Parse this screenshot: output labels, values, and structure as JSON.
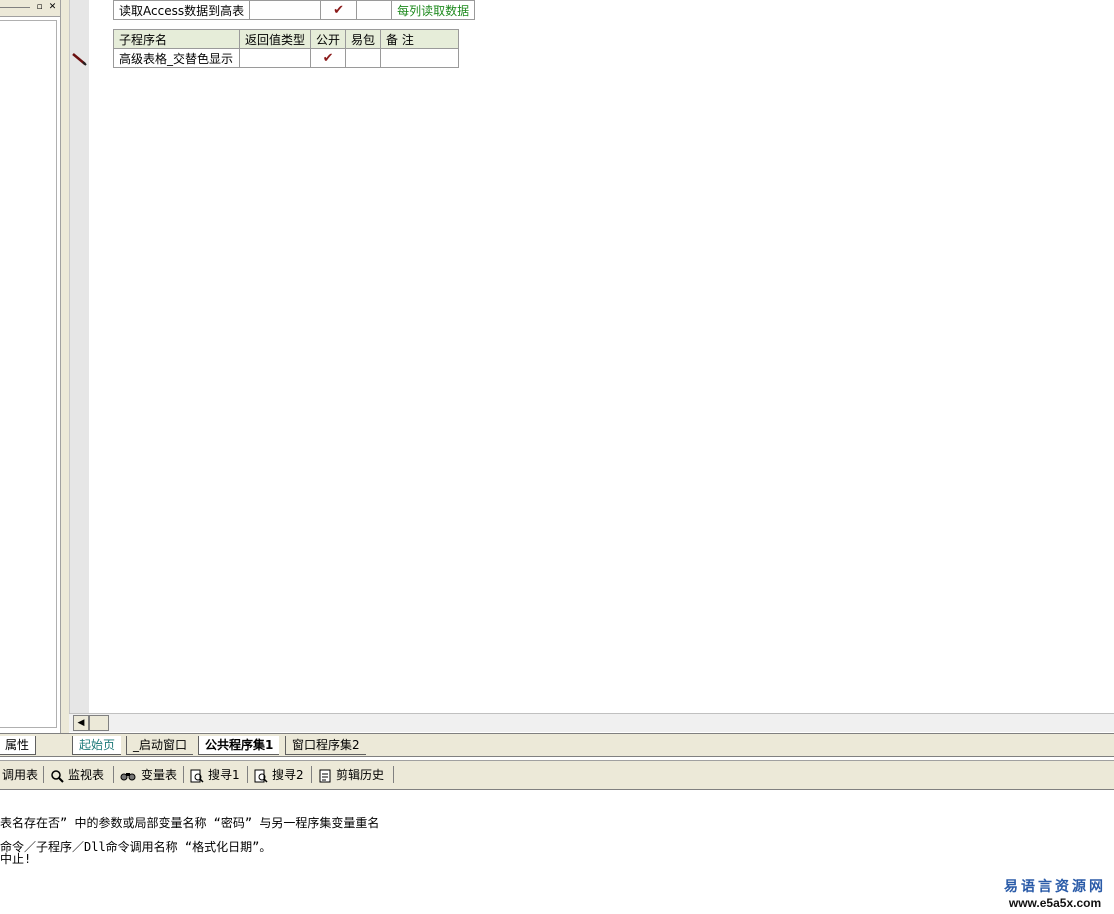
{
  "left_panel": {
    "property_tab": "属性"
  },
  "row_top": {
    "name": "读取Access数据到高表",
    "public_check": "✔",
    "remark": "每列读取数据"
  },
  "sub_table": {
    "headers": [
      "子程序名",
      "返回值类型",
      "公开",
      "易包",
      "备 注"
    ],
    "row": {
      "name": "高级表格_交替色显示",
      "return_type": "",
      "public_check": "✔",
      "easy_pack": "",
      "remark": ""
    }
  },
  "gutter": {
    "plus_symbol": "+"
  },
  "tabs": [
    "起始页",
    "_启动窗口",
    "公共程序集1",
    "窗口程序集2"
  ],
  "toolbar": {
    "items": [
      "调用表",
      "监视表",
      "变量表",
      "搜寻1",
      "搜寻2",
      "剪辑历史"
    ]
  },
  "output": {
    "line1": "表名存在否” 中的参数或局部变量名称 “密码” 与另一程序集变量重名",
    "line2": "命令／子程序／Dll命令调用名称 “格式化日期”。",
    "line3": "中止!"
  },
  "watermark": {
    "cn": "易语言资源网",
    "url": "www.e5a5x.com"
  },
  "colors": {
    "header_bg": "#e6edd9",
    "check": "#8b1a1a",
    "remark_green": "#1e8a1e",
    "active_tab_text": "#1e7a7a"
  }
}
